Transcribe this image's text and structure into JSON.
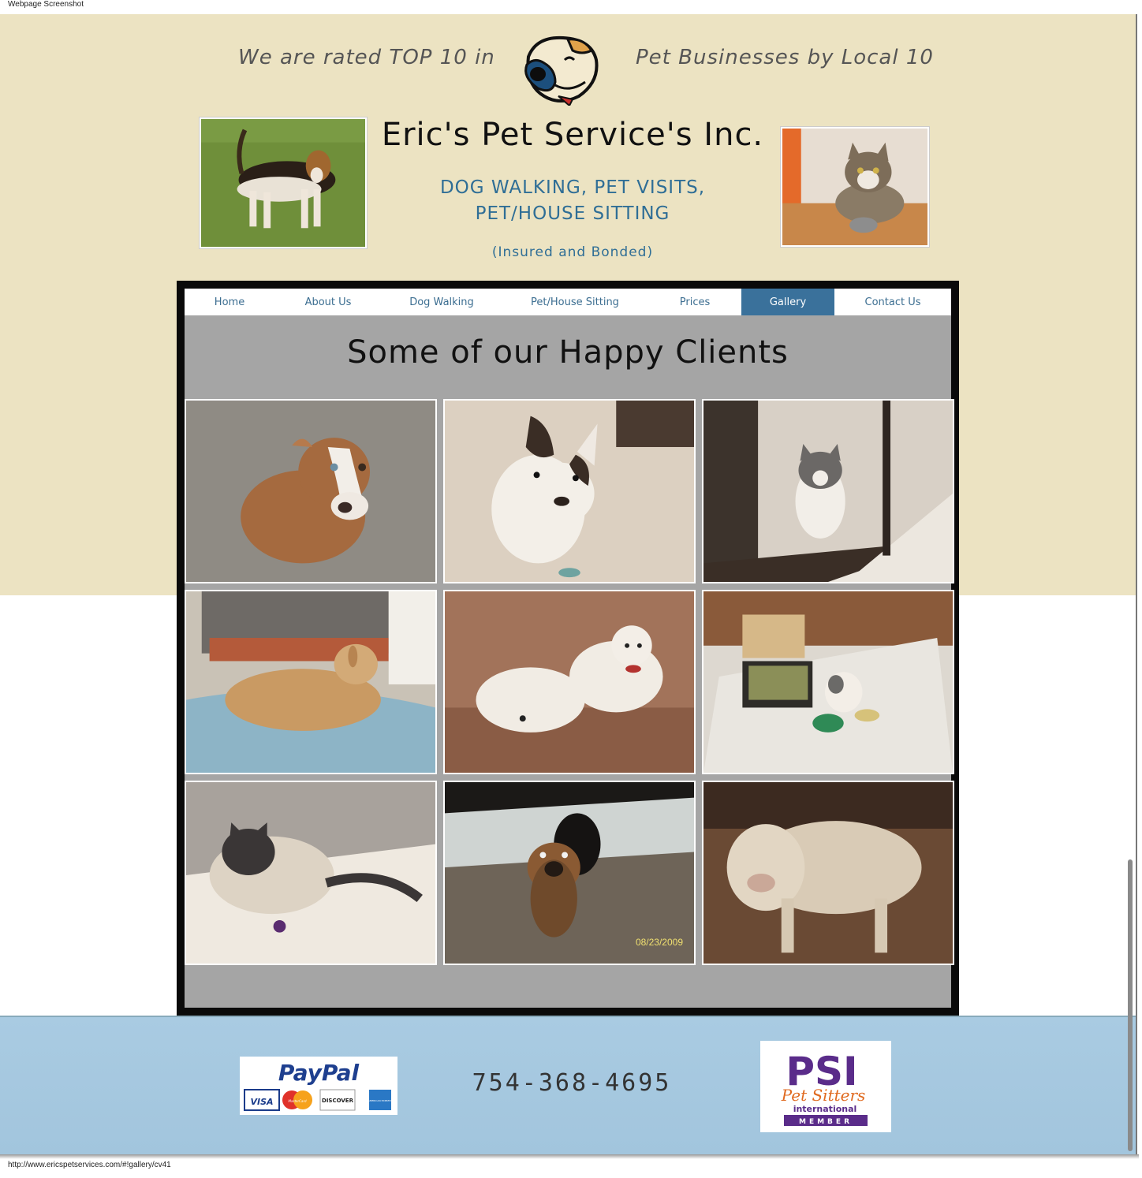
{
  "window": {
    "label": "Webpage Screenshot",
    "status_url": "http://www.ericspetservices.com/#!gallery/cv41"
  },
  "header": {
    "tagline_left": "We are rated TOP 10 in",
    "tagline_right": "Pet Businesses by Local 10",
    "title": "Eric's Pet Service's Inc.",
    "services_line1": "DOG WALKING, PET VISITS,",
    "services_line2": "PET/HOUSE SITTING",
    "insured": "(Insured and Bonded)"
  },
  "nav": {
    "items": [
      {
        "label": "Home",
        "active": false
      },
      {
        "label": "About Us",
        "active": false
      },
      {
        "label": "Dog Walking",
        "active": false
      },
      {
        "label": "Pet/House Sitting",
        "active": false
      },
      {
        "label": "Prices",
        "active": false
      },
      {
        "label": "Gallery",
        "active": true
      },
      {
        "label": "Contact Us",
        "active": false
      }
    ]
  },
  "gallery": {
    "title": "Some of our Happy Clients",
    "photo_date_stamp": "08/23/2009"
  },
  "footer": {
    "paypal_brand": "PayPal",
    "cards": [
      "VISA",
      "MasterCard",
      "DISCOVER",
      "AMERICAN EXPRESS"
    ],
    "phone": "754-368-4695",
    "psi_brand": "PSI",
    "psi_line1": "Pet Sitters",
    "psi_line2": "international",
    "psi_line3": "MEMBER"
  },
  "colors": {
    "cream": "#ece3c2",
    "nav_active": "#3a719b",
    "link_blue": "#2f6e96",
    "footer_blue": "#a9cbe2",
    "panel_gray": "#a5a5a5"
  }
}
